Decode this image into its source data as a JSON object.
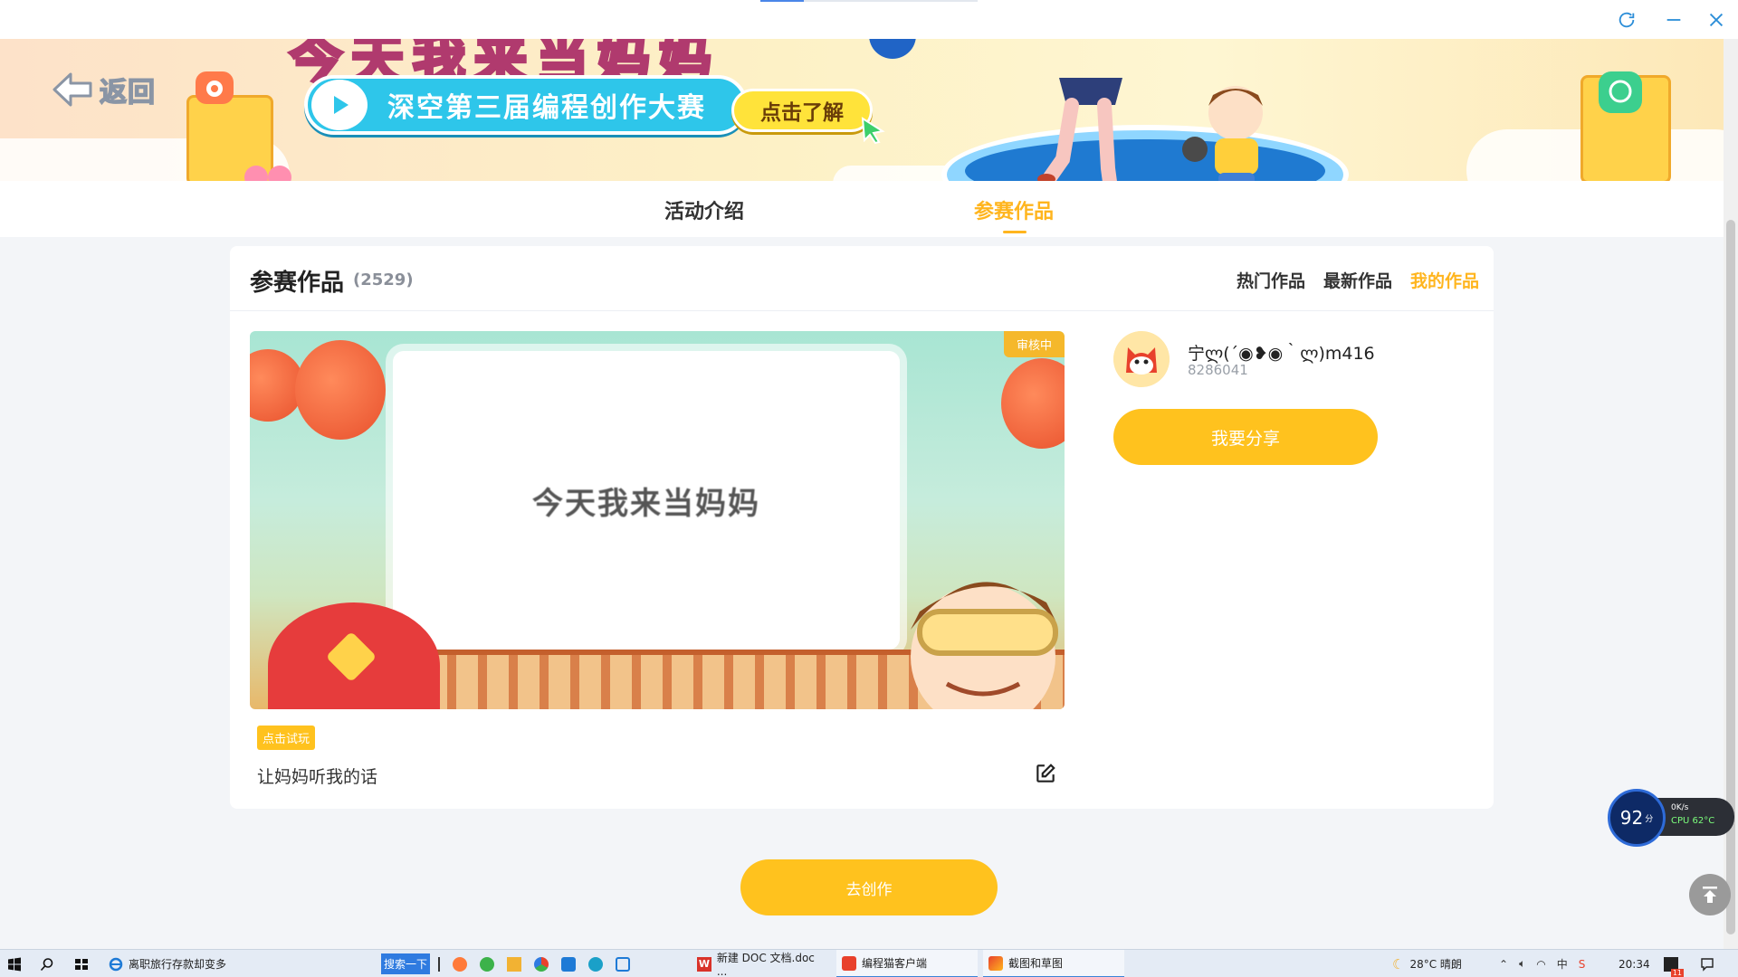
{
  "window": {
    "refresh_icon": "refresh-icon",
    "minimize_icon": "minimize-icon",
    "close_icon": "close-icon",
    "accent": "#2c8ed8"
  },
  "banner": {
    "back_label": "返回",
    "big_title": "今天我来当妈妈",
    "contest_label": "深空第三届编程创作大赛",
    "learn_more_label": "点击了解"
  },
  "tabs": [
    {
      "label": "活动介绍",
      "active": false
    },
    {
      "label": "参赛作品",
      "active": true
    }
  ],
  "card": {
    "title": "参赛作品",
    "count": "(2529)",
    "filters": [
      {
        "label": "热门作品",
        "active": false
      },
      {
        "label": "最新作品",
        "active": false
      },
      {
        "label": "我的作品",
        "active": true
      }
    ],
    "work": {
      "status_badge": "审核中",
      "screen_text": "今天我来当妈妈",
      "play_tag": "点击试玩",
      "name": "让妈妈听我的话",
      "edit_icon": "edit-icon"
    },
    "user": {
      "name": "宁ლ(´◉❥◉｀ლ)m416",
      "id": "8286041",
      "share_label": "我要分享"
    }
  },
  "create_label": "去创作",
  "widget": {
    "score": "92",
    "score_unit": "分",
    "net": "0K/s",
    "cpu": "CPU 62°C"
  },
  "taskbar": {
    "tasks": [
      {
        "label": "离职旅行存款却变多",
        "icon": "ie-icon"
      },
      {
        "label": "新建 DOC 文档.doc ...",
        "icon": "wps-icon"
      },
      {
        "label": "编程猫客户端",
        "icon": "codemao-icon"
      },
      {
        "label": "截图和草图",
        "icon": "snip-icon"
      }
    ],
    "search_button": "搜索一下",
    "weather": "28°C  晴朗",
    "time": "20:34",
    "badge": "11"
  },
  "colors": {
    "brand_yellow": "#ffc21e",
    "active_tab": "#ffb51e",
    "page_bg": "#f3f5f8"
  }
}
